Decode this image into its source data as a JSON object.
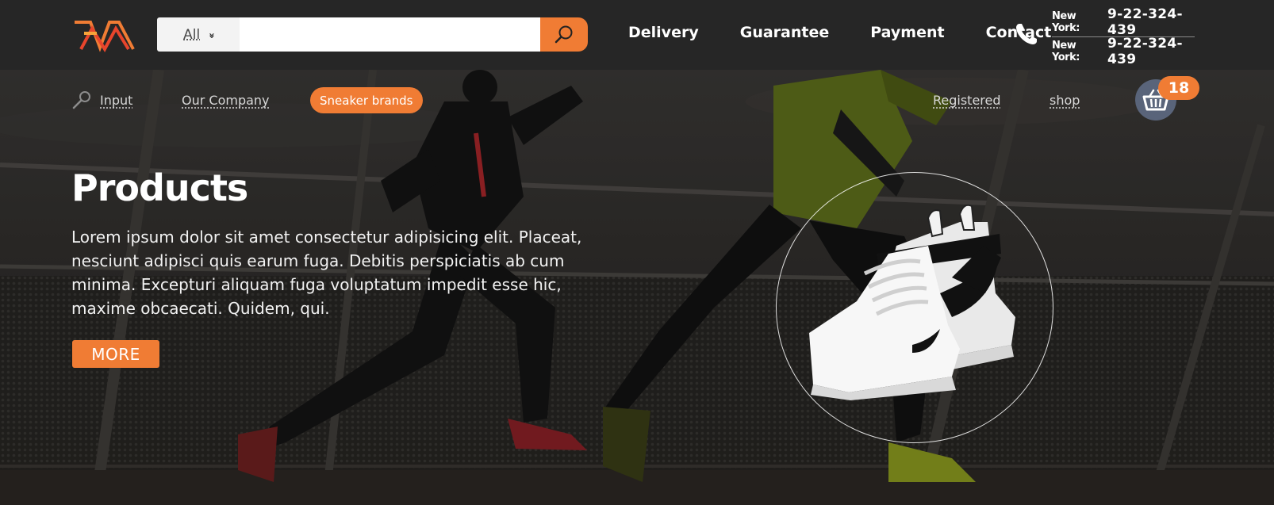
{
  "header": {
    "search": {
      "category": "All",
      "placeholder": ""
    },
    "nav": [
      "Delivery",
      "Guarantee",
      "Payment",
      "Contact"
    ],
    "phones": [
      {
        "city": "New York:",
        "number": "9-22-324-439"
      },
      {
        "city": "New York:",
        "number": "9-22-324-439"
      }
    ]
  },
  "subnav": {
    "input": "Input",
    "company": "Our Company",
    "brands": "Sneaker brands",
    "registered": "Registered",
    "shop": "shop"
  },
  "cart": {
    "count": "18"
  },
  "hero": {
    "title": "Products",
    "text": "Lorem ipsum dolor sit amet consectetur adipisicing elit. Placeat, nesciunt adipisci quis earum fuga. Debitis perspiciatis ab cum minima. Excepturi aliquam fuga voluptatum impedit esse hic, maxime obcaecati. Quidem, qui.",
    "button": "MORE"
  },
  "colors": {
    "accent": "#f07c34",
    "header_bg": "#262626",
    "cart_bg": "#59647a"
  },
  "icons": [
    "logo-icon",
    "chevron-down-icon",
    "search-icon",
    "phone-icon",
    "key-icon",
    "basket-icon"
  ]
}
